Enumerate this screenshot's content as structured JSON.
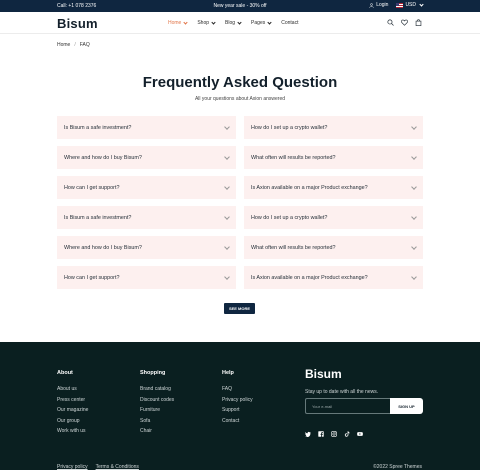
{
  "topbar": {
    "call": "Call: +1 078 2376",
    "promo": "New year sale - 30% off",
    "login": "Login",
    "currency": "USD"
  },
  "header": {
    "logo": "Bisum",
    "nav": [
      {
        "label": "Home",
        "active": true
      },
      {
        "label": "Shop",
        "active": false
      },
      {
        "label": "Blog",
        "active": false
      },
      {
        "label": "Pages",
        "active": false
      },
      {
        "label": "Contact",
        "active": false
      }
    ],
    "icons": [
      "search-icon",
      "heart-icon",
      "bag-icon"
    ],
    "accent_color": "#e2774b"
  },
  "breadcrumb": {
    "home": "Home",
    "separator": "/",
    "current": "FAQ"
  },
  "page": {
    "title": "Frequently Asked Question",
    "subtitle": "All your questions about Axion answered"
  },
  "faq": {
    "items": [
      "Is Bisum a safe investment?",
      "How do I set up a crypto wallet?",
      "Where and how do I buy Bisum?",
      "What often will results be reported?",
      "How can I get support?",
      "Is Axion available on a major Product exchange?",
      "Is Bisum a safe investment?",
      "How do I set up a crypto wallet?",
      "Where and how do I buy Bisum?",
      "What often will results be reported?",
      "How can I get support?",
      "Is Axion available on a major Product exchange?"
    ],
    "item_bg": "#fdf0ef",
    "see_more": "SEE MORE"
  },
  "footer": {
    "about": {
      "title": "About",
      "links": [
        "About us",
        "Press center",
        "Our magazine",
        "Our group",
        "Work with us"
      ]
    },
    "shopping": {
      "title": "Shopping",
      "links": [
        "Brand catalog",
        "Discount codes",
        "Furniture",
        "Sofa",
        "Chair"
      ]
    },
    "help": {
      "title": "Help",
      "links": [
        "FAQ",
        "Privacy policy",
        "Support",
        "Contact"
      ]
    },
    "brand": {
      "logo": "Bisum",
      "tagline": "Stay up to date with all the news.",
      "email_placeholder": "Your e-mail",
      "signup": "SIGN UP"
    },
    "social": [
      "twitter-icon",
      "facebook-icon",
      "instagram-icon",
      "tiktok-icon",
      "youtube-icon"
    ],
    "bottom": {
      "privacy": "Privacy policy",
      "terms": "Terms & Conditions",
      "copyright": "©2022 Spree Themes"
    },
    "bg_color": "#0a1f20"
  }
}
